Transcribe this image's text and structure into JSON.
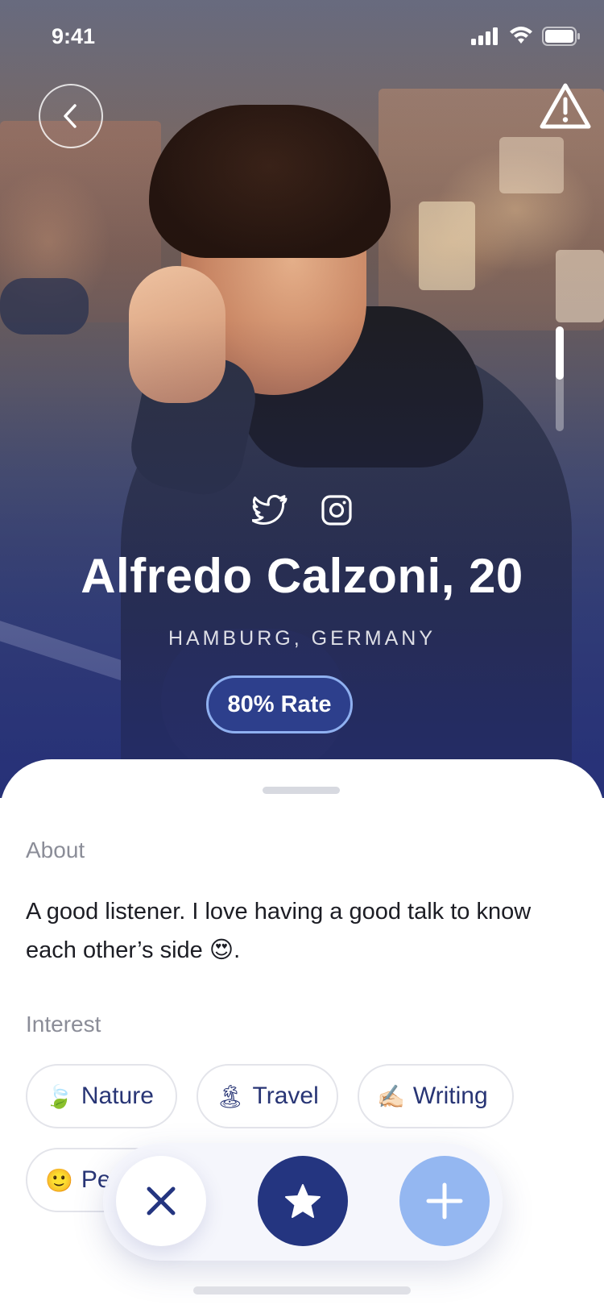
{
  "status_bar": {
    "time": "9:41"
  },
  "profile": {
    "name": "Alfredo Calzoni, 20",
    "location": "HAMBURG, GERMANY",
    "rate": "80% Rate",
    "socials": [
      "twitter-icon",
      "instagram-icon"
    ]
  },
  "about": {
    "label": "About",
    "text": "A good listener. I love having a good talk to know each other’s side 😍."
  },
  "interest": {
    "label": "Interest",
    "items": [
      {
        "emoji": "🍃",
        "label": "Nature"
      },
      {
        "emoji": "🏝",
        "label": "Travel"
      },
      {
        "emoji": "✍🏻",
        "label": "Writing"
      },
      {
        "emoji": "🙂",
        "label": "Pe"
      }
    ]
  },
  "actions": [
    "close-icon",
    "star-icon",
    "plus-icon"
  ],
  "colors": {
    "brand_navy": "#243580",
    "accent_blue": "#94b7f1",
    "rate_badge_bg": "#2d3f8c",
    "chip_text": "#283575",
    "muted_label": "#8b8d98"
  }
}
